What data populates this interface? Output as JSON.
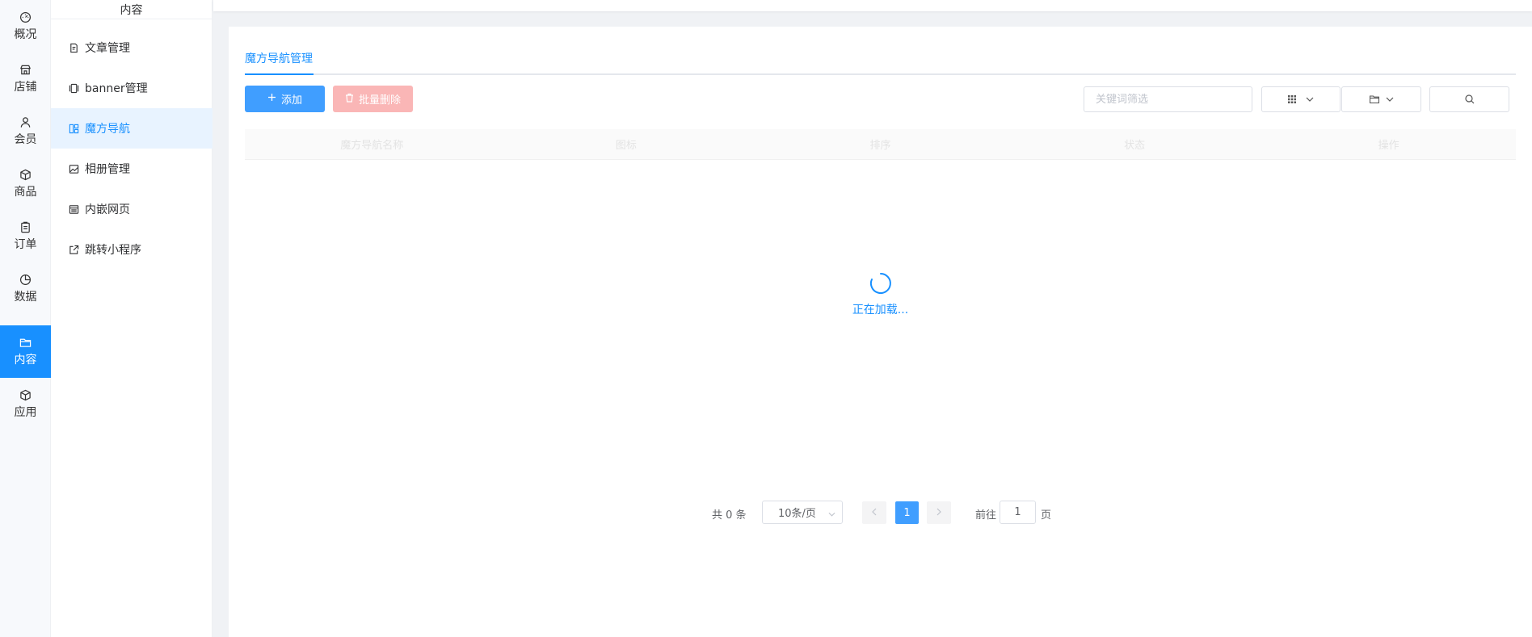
{
  "primary_nav": [
    {
      "label": "概况",
      "icon": "dashboard-icon"
    },
    {
      "label": "店铺",
      "icon": "shop-icon"
    },
    {
      "label": "会员",
      "icon": "user-icon"
    },
    {
      "label": "商品",
      "icon": "box-icon"
    },
    {
      "label": "订单",
      "icon": "clipboard-icon"
    },
    {
      "label": "数据",
      "icon": "pie-chart-icon"
    },
    {
      "label": "内容",
      "icon": "folder-icon",
      "active": true
    },
    {
      "label": "应用",
      "icon": "cube-icon"
    }
  ],
  "secondary_nav": {
    "header": "内容",
    "items": [
      {
        "label": "文章管理",
        "icon": "edit-doc-icon"
      },
      {
        "label": "banner管理",
        "icon": "carousel-icon"
      },
      {
        "label": "魔方导航",
        "icon": "layout-icon",
        "active": true
      },
      {
        "label": "相册管理",
        "icon": "picture-icon"
      },
      {
        "label": "内嵌网页",
        "icon": "webpage-icon"
      },
      {
        "label": "跳转小程序",
        "icon": "external-link-icon"
      }
    ]
  },
  "main": {
    "tab_label": "魔方导航管理",
    "add_button": "添加",
    "batch_delete_button": "批量删除",
    "search_placeholder": "关键词筛选",
    "table_headers": [
      "魔方导航名称",
      "图标",
      "排序",
      "状态",
      "操作"
    ],
    "loading_text": "正在加载...",
    "pagination": {
      "total": "共 0 条",
      "page_size": "10条/页",
      "current_page": "1",
      "goto_prefix": "前往",
      "goto_value": "1",
      "goto_suffix": "页"
    }
  },
  "colors": {
    "accent": "#1890ff",
    "primary_button": "#409eff",
    "danger_disabled": "#fab6b6",
    "active_bg": "#e8f3ff"
  }
}
